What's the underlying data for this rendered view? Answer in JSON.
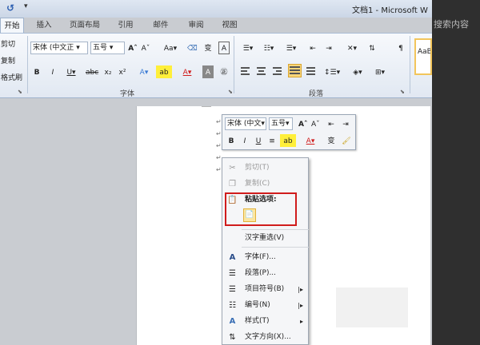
{
  "window": {
    "title": "文档1 - Microsoft W"
  },
  "qat": {
    "save_icon": "undo-icon"
  },
  "tabs": [
    "开始",
    "插入",
    "页面布局",
    "引用",
    "邮件",
    "审阅",
    "视图"
  ],
  "clipboard": {
    "cut": "剪切",
    "copy": "复制",
    "painter": "格式刷"
  },
  "font": {
    "name": "宋体 (中文正",
    "size": "五号",
    "label": "字体"
  },
  "paragraph": {
    "label": "段落"
  },
  "styles": {
    "preview": "AaB"
  },
  "search_hint": "搜索内容",
  "mini_toolbar": {
    "font": "宋体 (中文",
    "size": "五号"
  },
  "context_menu": {
    "cut": "剪切(T)",
    "copy": "复制(C)",
    "paste_options": "粘贴选项:",
    "reconvert": "汉字重选(V)",
    "font": "字体(F)...",
    "paragraph": "段落(P)...",
    "bullets": "项目符号(B)",
    "numbering": "编号(N)",
    "styles": "样式(T)",
    "text_direction": "文字方向(X)..."
  },
  "colors": {
    "accent_red": "#d01c1c",
    "ribbon": "#e1e8f2"
  }
}
